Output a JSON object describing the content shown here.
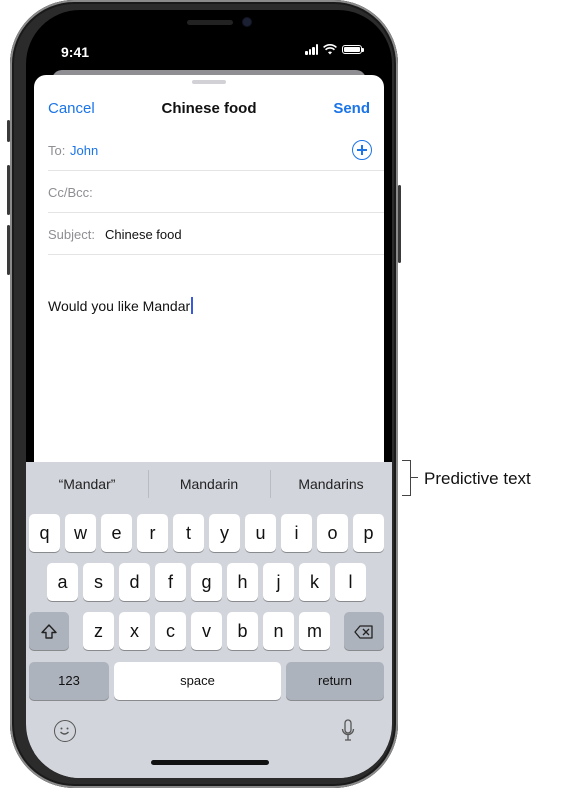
{
  "status_bar": {
    "time": "9:41"
  },
  "compose": {
    "cancel_label": "Cancel",
    "title": "Chinese food",
    "send_label": "Send",
    "to_label": "To:",
    "to_value": "John",
    "ccbcc_label": "Cc/Bcc:",
    "subject_label": "Subject:",
    "subject_value": "Chinese food",
    "body_text": "Would you like Mandar"
  },
  "keyboard": {
    "predictions": [
      "“Mandar”",
      "Mandarin",
      "Mandarins"
    ],
    "row1": [
      "q",
      "w",
      "e",
      "r",
      "t",
      "y",
      "u",
      "i",
      "o",
      "p"
    ],
    "row2": [
      "a",
      "s",
      "d",
      "f",
      "g",
      "h",
      "j",
      "k",
      "l"
    ],
    "row3": [
      "z",
      "x",
      "c",
      "v",
      "b",
      "n",
      "m"
    ],
    "numbers_label": "123",
    "space_label": "space",
    "return_label": "return"
  },
  "callout": {
    "label": "Predictive text"
  },
  "icons": [
    "shift-icon",
    "backspace-icon",
    "emoji-icon",
    "microphone-icon",
    "add-contact-icon",
    "wifi-icon",
    "battery-icon",
    "signal-icon"
  ],
  "colors": {
    "accent": "#1b74e8",
    "keyboard_bg": "#d2d5db",
    "dark_key": "#adb3bc"
  }
}
